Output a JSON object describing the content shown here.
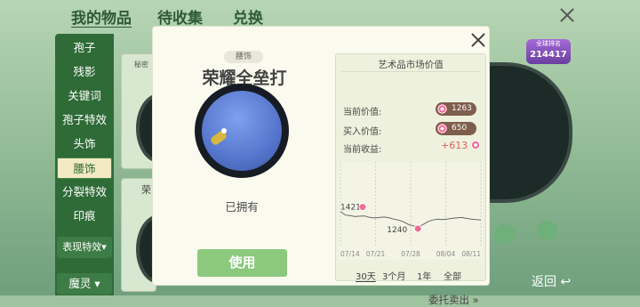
{
  "top_tabs": [
    {
      "label": "我的物品",
      "active": true
    },
    {
      "label": "待收集",
      "active": false
    },
    {
      "label": "兑换",
      "active": false
    }
  ],
  "sidebar": {
    "items": [
      {
        "label": "孢子"
      },
      {
        "label": "残影"
      },
      {
        "label": "关键词"
      },
      {
        "label": "孢子特效"
      },
      {
        "label": "头饰"
      },
      {
        "label": "腰饰",
        "active": true
      },
      {
        "label": "分裂特效"
      },
      {
        "label": "印痕"
      }
    ],
    "dropdowns": [
      {
        "label": "表现特效▾"
      },
      {
        "label": "魔灵 ▾"
      }
    ]
  },
  "background": {
    "card_label_1": "秘密",
    "card_label_2": "荣",
    "rank_badge": {
      "title": "全球排名",
      "value": "214417"
    },
    "back_label": "返回"
  },
  "modal": {
    "item_tag": "腰饰",
    "item_name": "荣耀全垒打",
    "status": "已拥有",
    "use_button": "使用",
    "market": {
      "title": "艺术品市场价值",
      "rows": [
        {
          "label": "当前价值:",
          "value": "1263"
        },
        {
          "label": "买入价值:",
          "value": "650"
        },
        {
          "label": "当前收益:",
          "value": "+613"
        }
      ],
      "range_tabs": [
        {
          "label": "30天",
          "active": true
        },
        {
          "label": "3个月",
          "active": false
        },
        {
          "label": "1年",
          "active": false
        },
        {
          "label": "全部",
          "active": false
        }
      ],
      "sell_link": "委托卖出 »"
    }
  },
  "colors": {
    "accent_green": "#8bc97d",
    "sidebar_green": "#2e6b37",
    "profit_red": "#e05f5f",
    "pill_brown": "#7e5e4c",
    "line_color": "#666666"
  },
  "chart_data": {
    "type": "line",
    "x_ticks": [
      "07/14",
      "07/21",
      "07/28",
      "08/04",
      "08/11"
    ],
    "series": [
      {
        "values": [
          1421,
          1378,
          1372,
          1360,
          1366,
          1368,
          1352,
          1345,
          1350,
          1355,
          1348,
          1330,
          1320,
          1300,
          1270,
          1252,
          1240,
          1265,
          1300,
          1320,
          1330,
          1325,
          1330,
          1340,
          1345,
          1350,
          1340,
          1330,
          1325,
          1322
        ]
      }
    ],
    "annotations": [
      {
        "label": "1421",
        "index": 0
      },
      {
        "label": "1240",
        "index": 16
      }
    ],
    "ylim": [
      1000,
      2000
    ]
  }
}
